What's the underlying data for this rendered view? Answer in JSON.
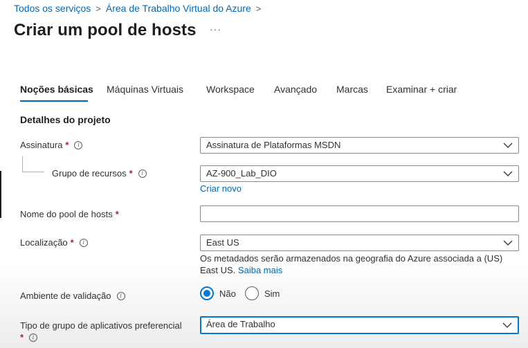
{
  "breadcrumb": {
    "items": [
      "Todos os serviços",
      "Área de Trabalho Virtual do Azure"
    ],
    "separator": ">"
  },
  "page": {
    "title": "Criar um pool de hosts",
    "more": "···"
  },
  "tabs": [
    {
      "label": "Noções básicas",
      "active": true
    },
    {
      "label": "Máquinas Virtuais"
    },
    {
      "label": "Workspace"
    },
    {
      "label": "Avançado"
    },
    {
      "label": "Marcas"
    },
    {
      "label": "Examinar + criar"
    }
  ],
  "section": {
    "title": "Detalhes do projeto"
  },
  "fields": {
    "subscription": {
      "label": "Assinatura",
      "required": "*",
      "value": "Assinatura de Plataformas MSDN"
    },
    "resource_group": {
      "label": "Grupo de recursos",
      "required": "*",
      "value": "AZ-900_Lab_DIO",
      "create_new": "Criar novo"
    },
    "pool_name": {
      "label": "Nome do pool de hosts",
      "required": "*",
      "value": ""
    },
    "location": {
      "label": "Localização",
      "required": "*",
      "value": "East US",
      "help_text_line1": "Os metadados serão armazenados na geografia do Azure associada a (US)",
      "help_text_line2": "East US.",
      "help_link": "Saiba mais"
    },
    "validation_env": {
      "label": "Ambiente de validação",
      "options": [
        {
          "label": "Não",
          "selected": true
        },
        {
          "label": "Sim",
          "selected": false
        }
      ]
    },
    "app_group_type": {
      "label": "Tipo de grupo de aplicativos preferencial",
      "required": "*",
      "value": "Área de Trabalho"
    }
  },
  "icons": {
    "info": "info-icon",
    "chevron": "chevron-down-icon",
    "breadcrumb_sep": "chevron-right-icon"
  },
  "colors": {
    "accent": "#0078d4",
    "link": "#0067b8",
    "required": "#a4262c"
  }
}
